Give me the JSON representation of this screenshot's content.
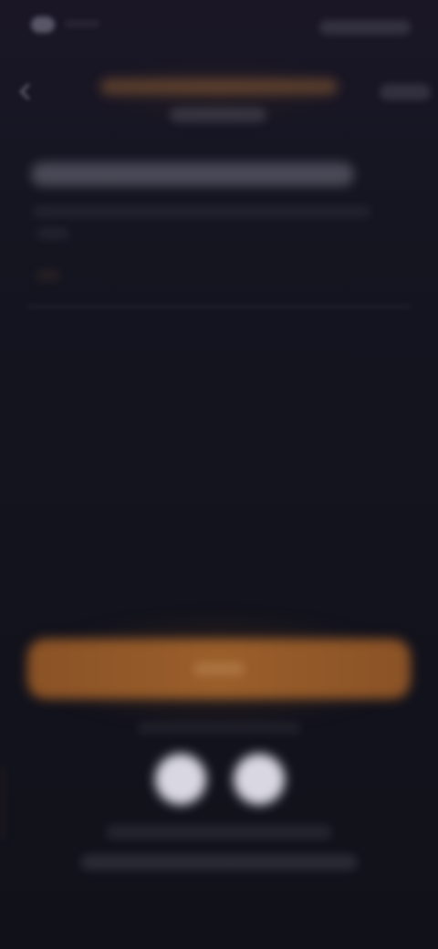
{
  "theme": {
    "background": "#13131d",
    "accent": "#9a5e2a",
    "title_color": "#d68a3c",
    "social_button": "#d9d8e2"
  },
  "status_bar": {
    "visible": true
  },
  "header": {
    "back_icon": "chevron-left-icon",
    "title": "",
    "subtitle": "",
    "action_label": ""
  },
  "content": {
    "heading": "",
    "description": ""
  },
  "cta": {
    "label": ""
  },
  "social": {
    "divider_text": "",
    "buttons": [
      "social-login-1",
      "social-login-2"
    ]
  },
  "footer": {
    "line1": "",
    "line2": ""
  }
}
